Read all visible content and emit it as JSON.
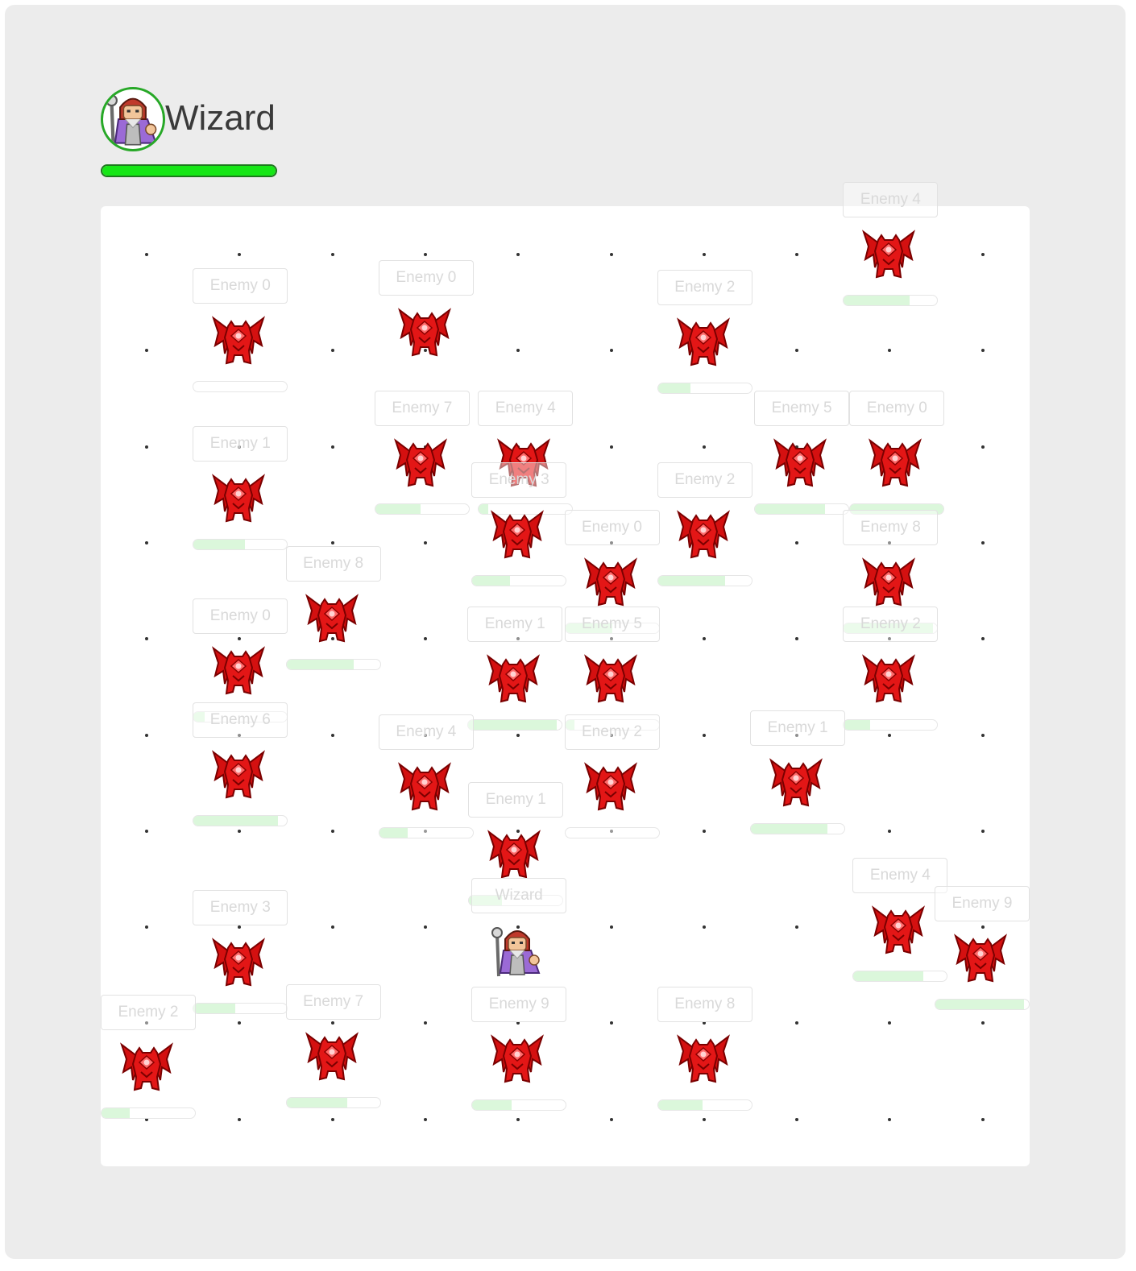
{
  "player": {
    "name": "Wizard",
    "health_fraction": 1.0,
    "avatar_icon": "wizard-icon"
  },
  "board": {
    "grid_columns": 10,
    "grid_rows": 10
  },
  "units": [
    {
      "label": "Enemy 4",
      "kind": "demon",
      "col": 8,
      "row": 0,
      "health": 0.7
    },
    {
      "label": "Enemy 0",
      "kind": "demon",
      "col": 3,
      "row": 1,
      "health": null
    },
    {
      "label": "Enemy 2",
      "kind": "demon",
      "col": 6,
      "row": 1,
      "health": 0.35
    },
    {
      "label": "Enemy 0",
      "kind": "demon",
      "col": 1,
      "row": 1,
      "health": 0.0
    },
    {
      "label": "Enemy 7",
      "kind": "demon",
      "col": 3,
      "row": 2,
      "health": 0.48
    },
    {
      "label": "Enemy 4",
      "kind": "demon",
      "col": 4,
      "row": 2,
      "health": 0.1
    },
    {
      "label": "Enemy 5",
      "kind": "demon",
      "col": 7,
      "row": 2,
      "health": 0.75
    },
    {
      "label": "Enemy 0",
      "kind": "demon",
      "col": 8,
      "row": 2,
      "health": 1.0
    },
    {
      "label": "Enemy 1",
      "kind": "demon",
      "col": 1,
      "row": 3,
      "health": 0.55
    },
    {
      "label": "Enemy 3",
      "kind": "demon",
      "col": 4,
      "row": 3,
      "health": 0.4
    },
    {
      "label": "Enemy 2",
      "kind": "demon",
      "col": 6,
      "row": 3,
      "health": 0.72
    },
    {
      "label": "Enemy 0",
      "kind": "demon",
      "col": 5,
      "row": 4,
      "health": 0.5
    },
    {
      "label": "Enemy 8",
      "kind": "demon",
      "col": 8,
      "row": 4,
      "health": 0.95
    },
    {
      "label": "Enemy 8",
      "kind": "demon",
      "col": 2,
      "row": 4,
      "health": 0.72
    },
    {
      "label": "Enemy 0",
      "kind": "demon",
      "col": 1,
      "row": 5,
      "health": 0.12
    },
    {
      "label": "Enemy 1",
      "kind": "demon",
      "col": 4,
      "row": 5,
      "health": 0.95
    },
    {
      "label": "Enemy 5",
      "kind": "demon",
      "col": 5,
      "row": 5,
      "health": 0.1
    },
    {
      "label": "Enemy 2",
      "kind": "demon",
      "col": 8,
      "row": 5,
      "health": 0.28
    },
    {
      "label": "Enemy 6",
      "kind": "demon",
      "col": 1,
      "row": 6,
      "health": 0.9
    },
    {
      "label": "Enemy 4",
      "kind": "demon",
      "col": 3,
      "row": 6,
      "health": 0.3
    },
    {
      "label": "Enemy 2",
      "kind": "demon",
      "col": 5,
      "row": 6,
      "health": 0.0
    },
    {
      "label": "Enemy 1",
      "kind": "demon",
      "col": 7,
      "row": 6,
      "health": 0.82
    },
    {
      "label": "Enemy 1",
      "kind": "demon",
      "col": 4,
      "row": 7,
      "health": 0.35
    },
    {
      "label": "Enemy 4",
      "kind": "demon",
      "col": 8,
      "row": 8,
      "health": 0.75
    },
    {
      "label": "Enemy 9",
      "kind": "demon",
      "col": 9,
      "row": 8,
      "health": 0.95
    },
    {
      "label": "Enemy 3",
      "kind": "demon",
      "col": 1,
      "row": 8,
      "health": 0.45
    },
    {
      "label": "Enemy 2",
      "kind": "demon",
      "col": 0,
      "row": 9,
      "health": 0.3
    },
    {
      "label": "Wizard",
      "kind": "wizard",
      "col": 4,
      "row": 8,
      "health": 1.0
    },
    {
      "label": "Enemy 7",
      "kind": "demon",
      "col": 2,
      "row": 9,
      "health": 0.65
    },
    {
      "label": "Enemy 9",
      "kind": "demon",
      "col": 4,
      "row": 9,
      "health": 0.42
    },
    {
      "label": "Enemy 8",
      "kind": "demon",
      "col": 6,
      "row": 9,
      "health": 0.48
    }
  ]
}
